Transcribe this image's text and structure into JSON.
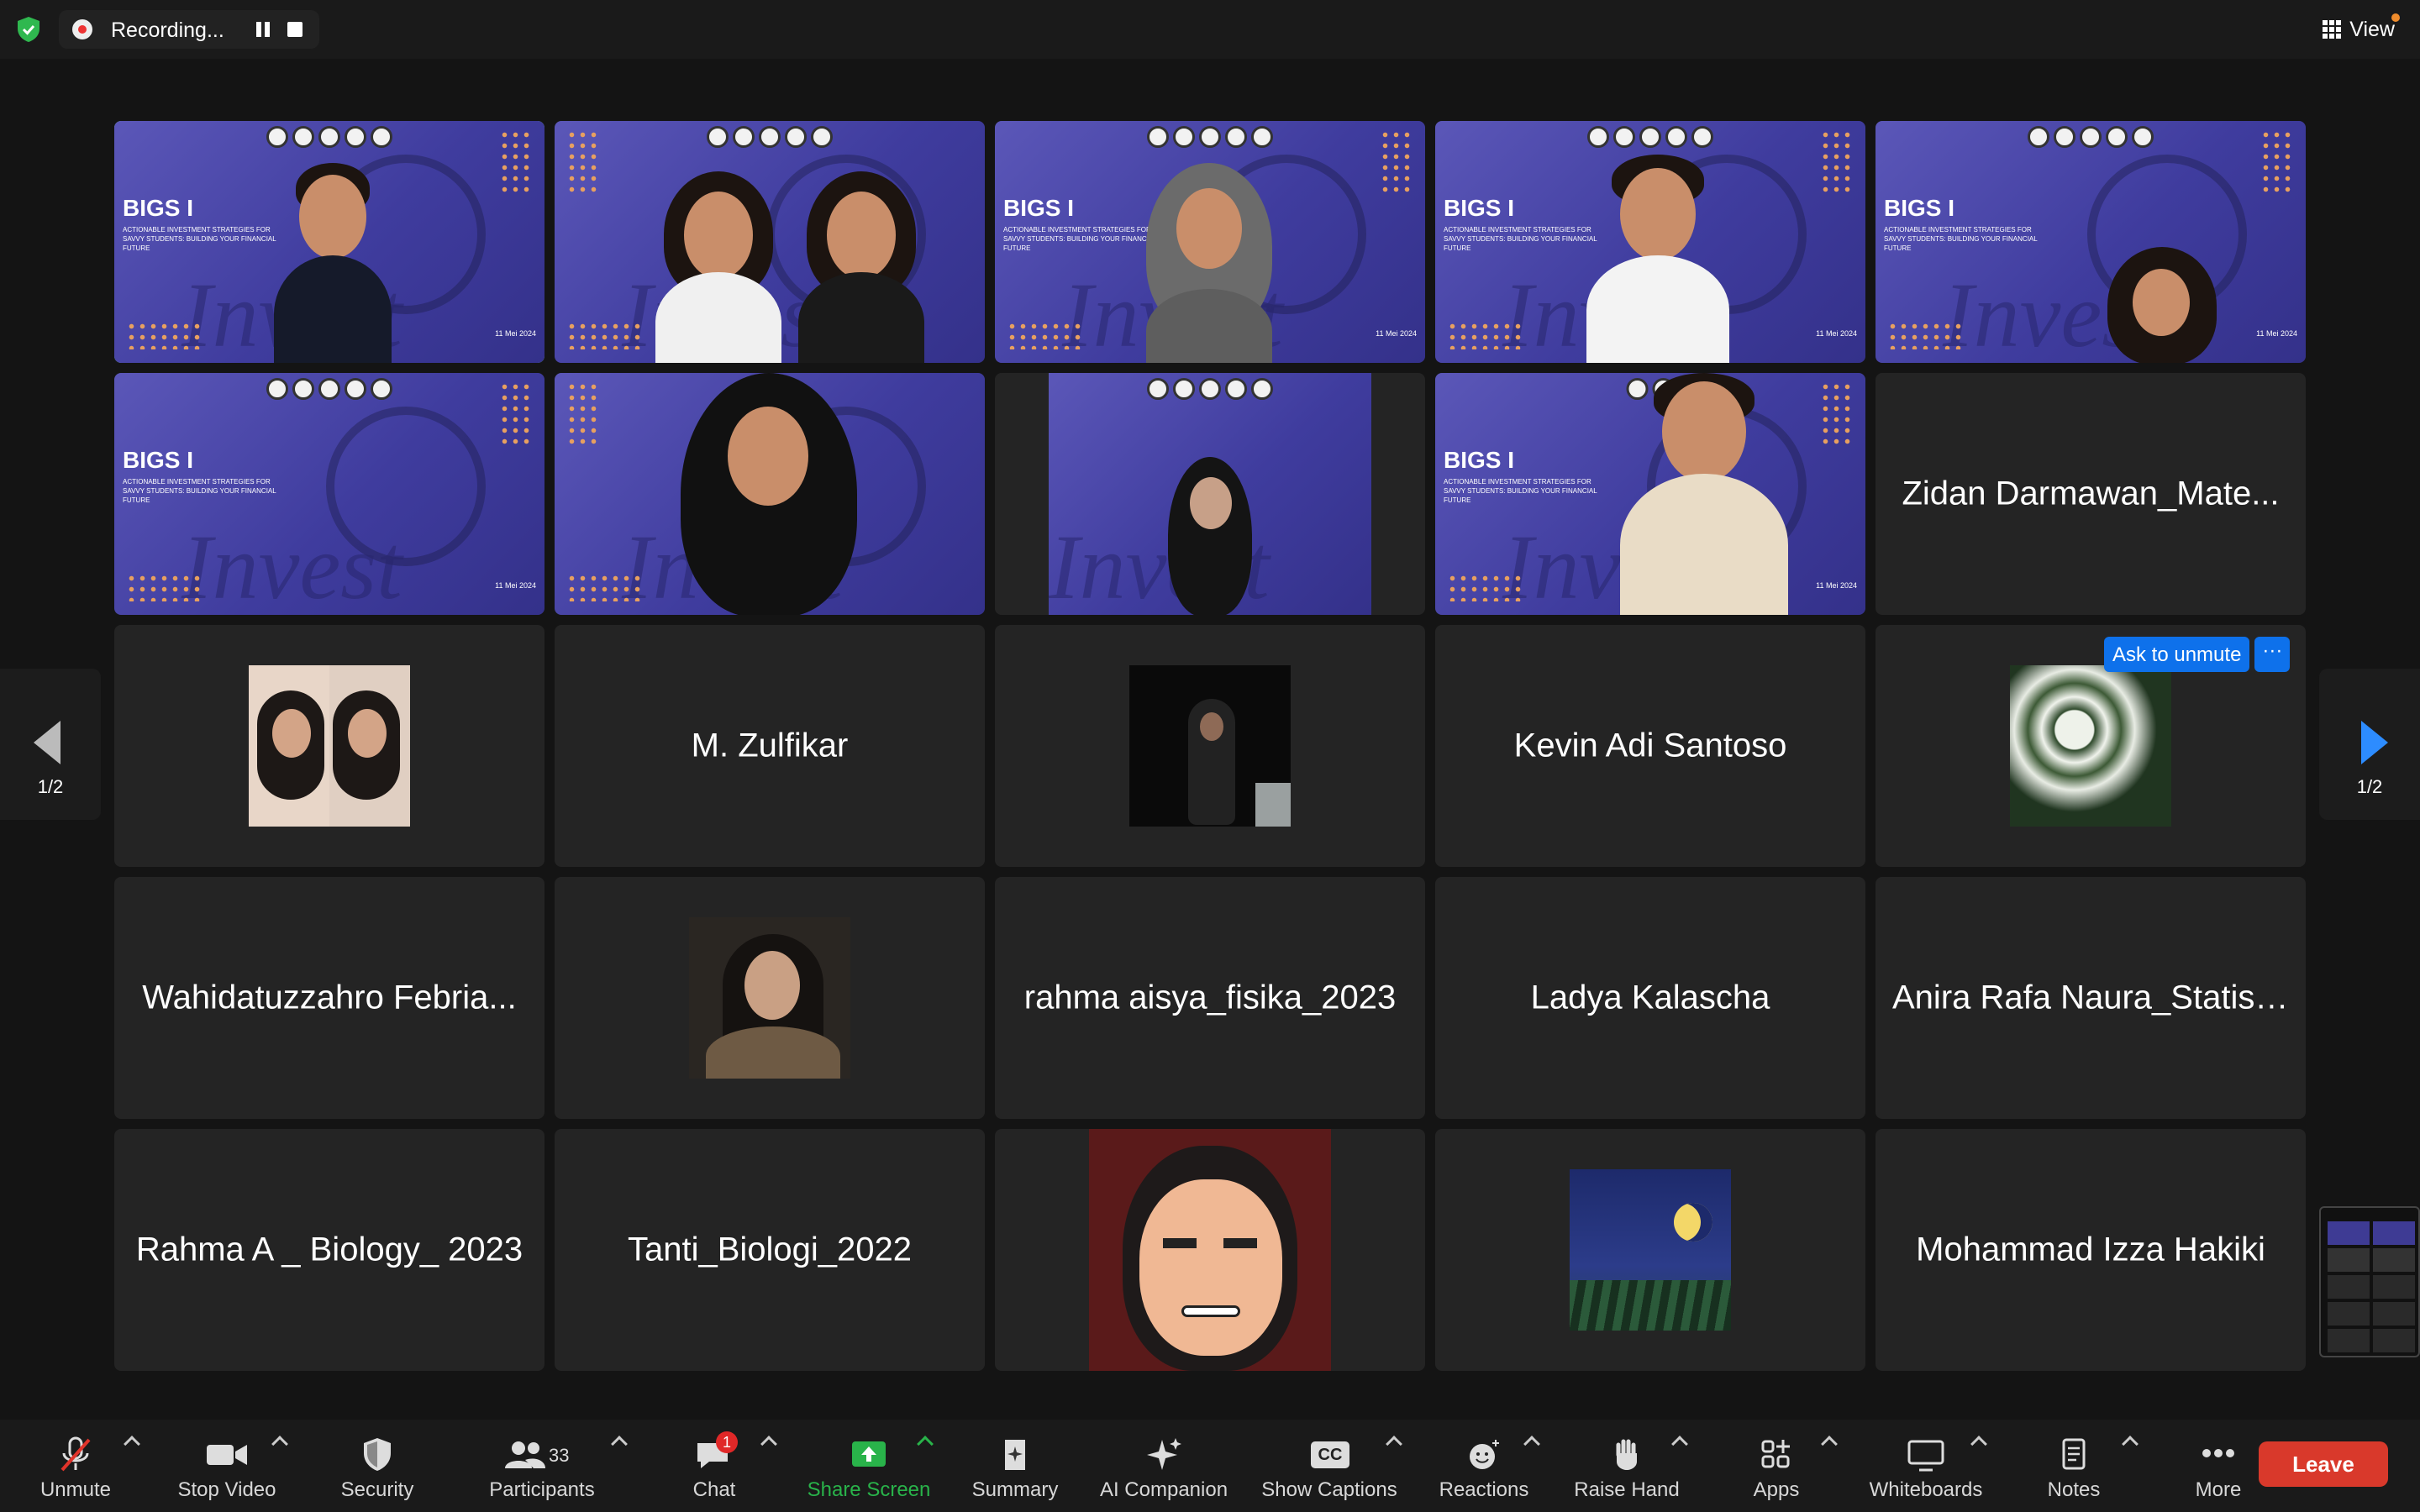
{
  "topbar": {
    "recording_label": "Recording...",
    "view_label": "View"
  },
  "tiles": [
    {
      "name": "",
      "type": "video"
    },
    {
      "name": "",
      "type": "video"
    },
    {
      "name": "",
      "type": "video"
    },
    {
      "name": "",
      "type": "video"
    },
    {
      "name": "",
      "type": "video"
    },
    {
      "name": "",
      "type": "video"
    },
    {
      "name": "",
      "type": "video"
    },
    {
      "name": "",
      "type": "video"
    },
    {
      "name": "",
      "type": "video"
    },
    {
      "name": "Zidan Darmawan_Mate...",
      "type": "name"
    },
    {
      "name": "",
      "type": "avatar"
    },
    {
      "name": "M. Zulfikar",
      "type": "name"
    },
    {
      "name": "",
      "type": "avatar"
    },
    {
      "name": "Kevin Adi Santoso",
      "type": "name"
    },
    {
      "name": "",
      "type": "avatar"
    },
    {
      "name": "Wahidatuzzahro Febria...",
      "type": "name"
    },
    {
      "name": "",
      "type": "avatar"
    },
    {
      "name": "rahma aisya_fisika_2023",
      "type": "name"
    },
    {
      "name": "Ladya Kalascha",
      "type": "name"
    },
    {
      "name": "Anira Rafa Naura_Statist...",
      "type": "name"
    },
    {
      "name": "Rahma A _ Biology_ 2023",
      "type": "name"
    },
    {
      "name": "Tanti_Biologi_2022",
      "type": "name"
    },
    {
      "name": "",
      "type": "avatar"
    },
    {
      "name": "",
      "type": "avatar"
    },
    {
      "name": "Mohammad Izza Hakiki",
      "type": "name"
    }
  ],
  "slide": {
    "title": "BIGS I",
    "subtitle": "ACTIONABLE INVESTMENT STRATEGIES FOR SAVVY STUDENTS: BUILDING YOUR FINANCIAL FUTURE",
    "watermark": "Invest",
    "date": "11 Mei 2024"
  },
  "ask_to_unmute": "Ask to unmute",
  "pagination": {
    "left": "1/2",
    "right": "1/2"
  },
  "toolbar": {
    "unmute": "Unmute",
    "stop_video": "Stop Video",
    "security": "Security",
    "participants": "Participants",
    "participants_count": "33",
    "chat": "Chat",
    "chat_badge": "1",
    "share_screen": "Share Screen",
    "summary": "Summary",
    "ai_companion": "AI Companion",
    "show_captions": "Show Captions",
    "captions_icon": "CC",
    "reactions": "Reactions",
    "raise_hand": "Raise Hand",
    "apps": "Apps",
    "whiteboards": "Whiteboards",
    "notes": "Notes",
    "more": "More",
    "leave": "Leave"
  },
  "colors": {
    "active_speaker_border": "#6cd86c",
    "share_green": "#29b34a",
    "leave_red": "#d9392b",
    "accent_blue": "#0e71eb"
  }
}
